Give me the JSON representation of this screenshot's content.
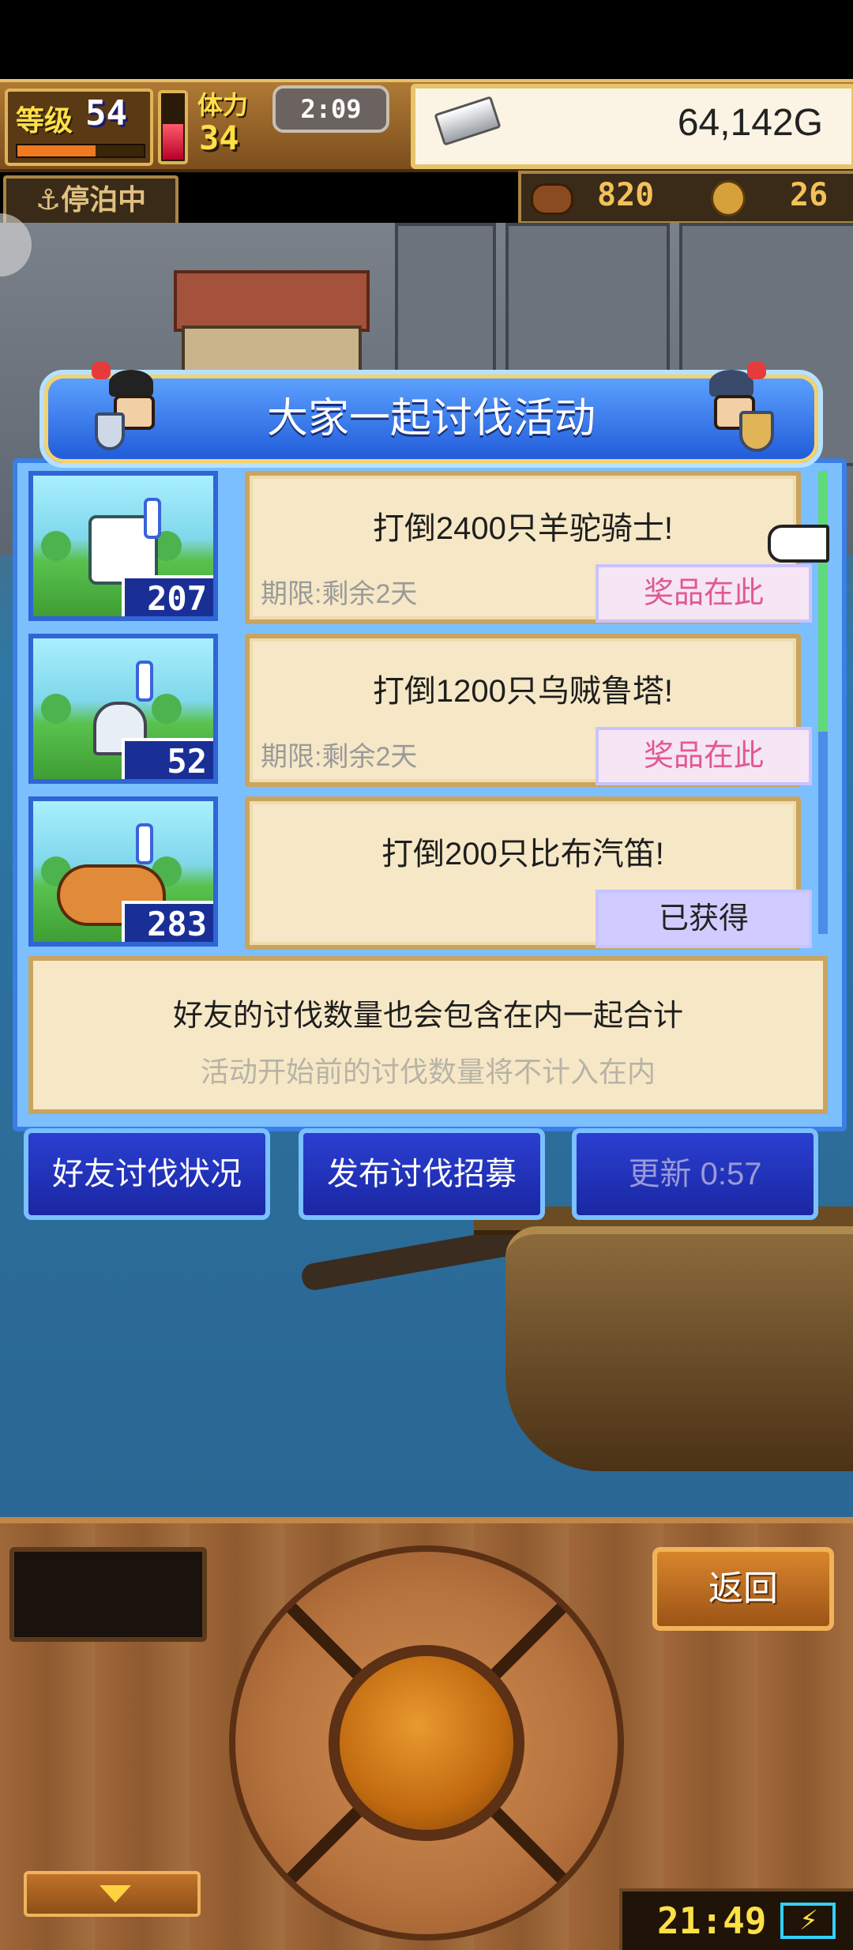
{
  "hud": {
    "level_label": "等级",
    "level_value": "54",
    "exp_fraction": 0.62,
    "stamina_label": "体力",
    "stamina_value": "34",
    "stamina_fraction": 0.55,
    "timer": "2:09",
    "gold": "64,142G",
    "status_badge": "停泊中",
    "meat_count": "820",
    "medal_count": "26"
  },
  "panel": {
    "title": "大家一起讨伐活动",
    "quests": [
      {
        "title": "打倒2400只羊驼骑士!",
        "deadline": "期限:剩余2天",
        "button": "奖品在此",
        "button_state": "prize",
        "count": "207"
      },
      {
        "title": "打倒1200只乌贼鲁塔!",
        "deadline": "期限:剩余2天",
        "button": "奖品在此",
        "button_state": "prize",
        "count": "52"
      },
      {
        "title": "打倒200只比布汽笛!",
        "deadline": "",
        "button": "已获得",
        "button_state": "claimed",
        "count": "283"
      }
    ],
    "info_line1": "好友的讨伐数量也会包含在内一起合计",
    "info_line2": "活动开始前的讨伐数量将不计入在内"
  },
  "actions": {
    "friends_status": "好友讨伐状况",
    "post_recruit": "发布讨伐招募",
    "refresh": "更新 0:57"
  },
  "controls": {
    "back": "返回",
    "clock": "21:49"
  },
  "colors": {
    "panel_blue": "#7bbfff",
    "title_blue": "#1f59d8",
    "prize_pink": "#e05a8f",
    "parchment": "#f6e8c6"
  }
}
